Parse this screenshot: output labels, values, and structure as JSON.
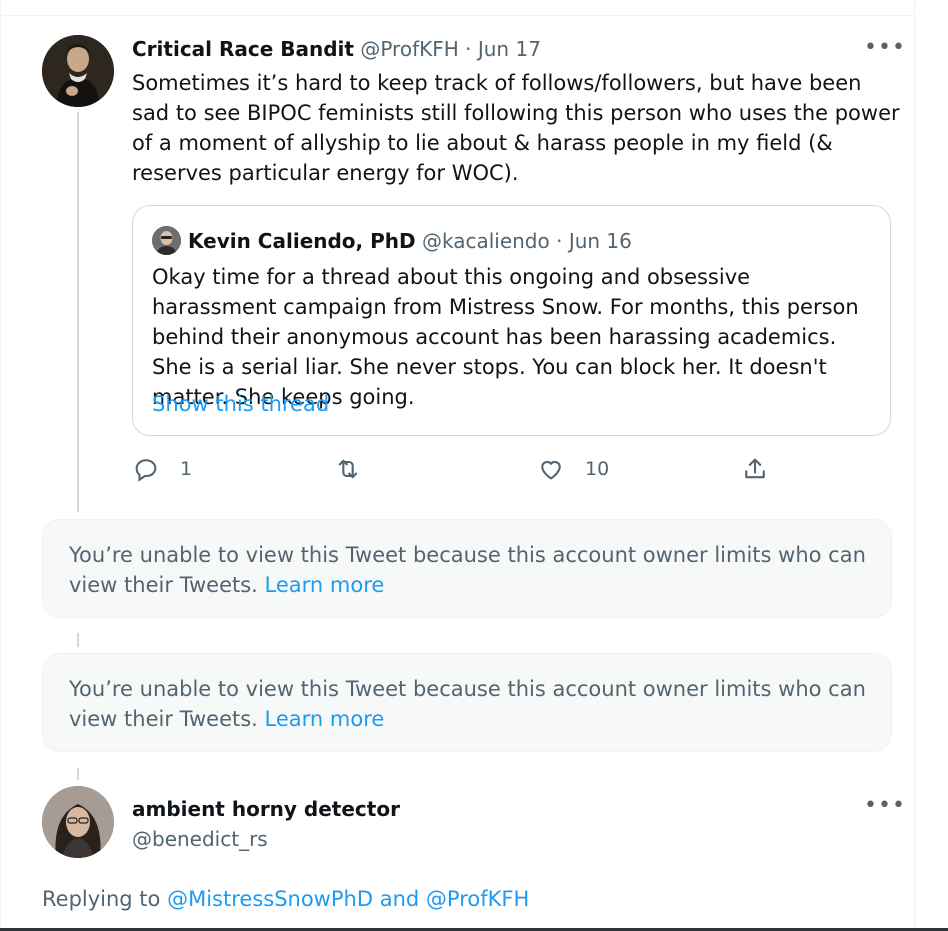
{
  "tweet1": {
    "name": "Critical Race Bandit",
    "handle": "@ProfKFH",
    "separator": "·",
    "date": "Jun 17",
    "more": "•••",
    "text": "Sometimes it’s hard to keep track of follows/followers, but have been sad to see BIPOC feminists still following this person who uses the power of a moment of allyship to lie about & harass people in my field (& reserves particular energy for WOC).",
    "quote": {
      "name": "Kevin Caliendo, PhD",
      "handle": "@kacaliendo",
      "separator": "·",
      "date": "Jun 16",
      "text": "Okay time for a thread about this ongoing and obsessive harassment campaign from Mistress Snow. For months, this person behind their anonymous account has been harassing academics. She is a serial liar. She never stops. You can block her. It doesn't matter. She keeps going.",
      "show_thread": "Show this thread"
    },
    "actions": {
      "reply_count": "1",
      "retweet_count": "",
      "like_count": "10"
    }
  },
  "unavailable": [
    {
      "text": "You’re unable to view this Tweet because this account owner limits who can view their Tweets.",
      "link": "Learn more"
    },
    {
      "text": "You’re unable to view this Tweet because this account owner limits who can view their Tweets.",
      "link": "Learn more"
    }
  ],
  "tweet2": {
    "name": "ambient horny detector",
    "handle": "@benedict_rs",
    "more": "•••",
    "replying_prefix": "Replying to",
    "mention1": "@MistressSnowPhD",
    "and": "and",
    "mention2": "@ProfKFH"
  },
  "colors": {
    "accent": "#1d9bf0",
    "secondary_text": "#536471",
    "primary_text": "#0f1419",
    "border": "#cfd9de"
  },
  "icons": [
    "reply-icon",
    "retweet-icon",
    "like-icon",
    "share-icon",
    "more-icon"
  ]
}
